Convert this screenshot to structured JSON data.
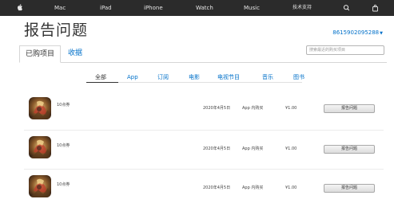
{
  "globalnav": {
    "items": [
      {
        "label": "Mac"
      },
      {
        "label": "iPad"
      },
      {
        "label": "iPhone"
      },
      {
        "label": "Watch"
      },
      {
        "label": "Music"
      },
      {
        "label": "技术支持"
      }
    ],
    "apple_logo_icon": "apple-logo-icon",
    "search_icon": "search-icon",
    "bag_icon": "bag-icon"
  },
  "header": {
    "title": "报告问题",
    "account": "8615902095288"
  },
  "tabs": [
    {
      "label": "已购项目",
      "active": true
    },
    {
      "label": "收据",
      "active": false
    }
  ],
  "search": {
    "placeholder": "搜索最近的购买项目"
  },
  "filters": [
    {
      "label": "全部",
      "active": true
    },
    {
      "label": "App",
      "active": false
    },
    {
      "label": "订阅",
      "active": false
    },
    {
      "label": "电影",
      "active": false
    },
    {
      "label": "电视节目",
      "active": false
    },
    {
      "label": "音乐",
      "active": false
    },
    {
      "label": "图书",
      "active": false
    }
  ],
  "purchases": [
    {
      "name": "10点券",
      "date": "2020年4月5日",
      "type": "App 内购买",
      "price": "¥1.00",
      "action": "报告问题"
    },
    {
      "name": "10点券",
      "date": "2020年4月5日",
      "type": "App 内购买",
      "price": "¥1.00",
      "action": "报告问题"
    },
    {
      "name": "10点券",
      "date": "2020年4月5日",
      "type": "App 内购买",
      "price": "¥1.00",
      "action": "报告问题"
    }
  ],
  "colors": {
    "nav_bg": "#2b2b2b",
    "link": "#0070c9",
    "text": "#333333"
  }
}
